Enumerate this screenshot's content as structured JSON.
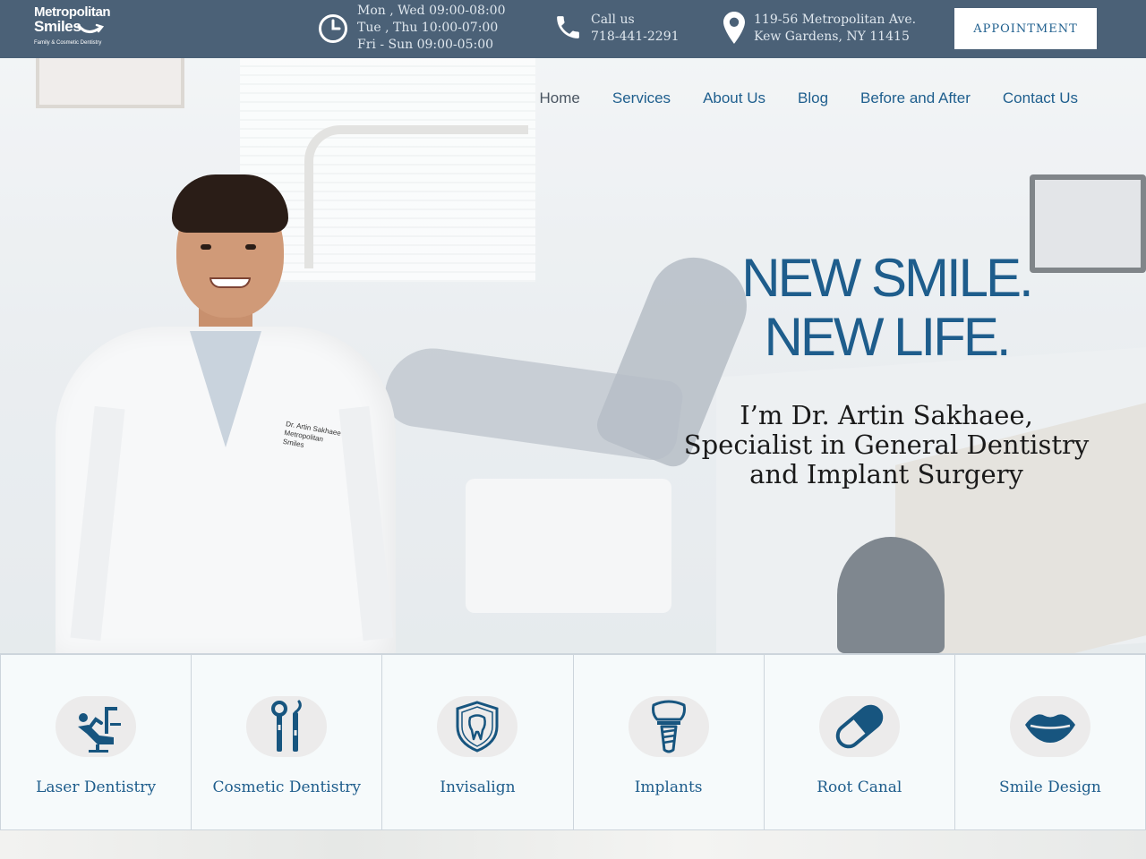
{
  "brand": {
    "name_line1": "Metropolitan",
    "name_line2": "Smiles",
    "tagline": "Family & Cosmetic Dentistry"
  },
  "header": {
    "hours": [
      "Mon , Wed 09:00-08:00",
      "Tue , Thu 10:00-07:00",
      "Fri - Sun 09:00-05:00"
    ],
    "call_label": "Call us",
    "phone": "718-441-2291",
    "address_line1": "119-56 Metropolitan Ave.",
    "address_line2": "Kew Gardens, NY 11415",
    "appointment_label": "APPOINTMENT"
  },
  "nav": {
    "items": [
      "Home",
      "Services",
      "About Us",
      "Blog",
      "Before and After",
      "Contact Us"
    ]
  },
  "hero": {
    "headline_line1": "NEW SMILE.",
    "headline_line2": "NEW LIFE.",
    "sub_line1": "I’m Dr. Artin Sakhaee,",
    "sub_line2": "Specialist in General Dentistry",
    "sub_line3": "and Implant Surgery",
    "coat_badge": "Dr. Artin Sakhaee Metropolitan Smiles"
  },
  "services": [
    {
      "label": "Laser Dentistry",
      "icon": "dental-chair-icon"
    },
    {
      "label": "Cosmetic Dentistry",
      "icon": "dental-tools-icon"
    },
    {
      "label": "Invisalign",
      "icon": "tooth-shield-icon"
    },
    {
      "label": "Implants",
      "icon": "tooth-implant-icon"
    },
    {
      "label": "Root Canal",
      "icon": "capsule-icon"
    },
    {
      "label": "Smile Design",
      "icon": "lips-icon"
    }
  ],
  "colors": {
    "topbar": "#4b6177",
    "accent": "#1e5d8c",
    "icon": "#17557f"
  }
}
